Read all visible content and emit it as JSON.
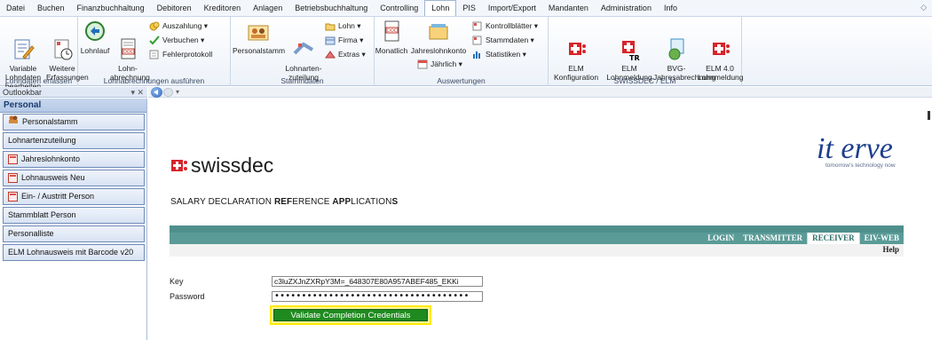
{
  "menu": {
    "tabs": [
      "Datei",
      "Buchen",
      "Finanzbuchhaltung",
      "Debitoren",
      "Kreditoren",
      "Anlagen",
      "Betriebsbuchhaltung",
      "Controlling",
      "Lohn",
      "PIS",
      "Import/Export",
      "Mandanten",
      "Administration",
      "Info"
    ],
    "active_tab": "Lohn"
  },
  "ribbon": {
    "lohndaten": {
      "group_label": "Lohndaten erfassen",
      "variable": "Variable Lohndaten\nbearbeiten",
      "weitere": "Weitere\nErfassungen"
    },
    "lohnabrechnungen": {
      "group_label": "Lohnabrechnungen ausführen",
      "lohnlauf": "Lohnlauf",
      "lohnabrechnung": "Lohn-\nabrechnung",
      "auszahlung": "Auszahlung ▾",
      "verbuchen": "Verbuchen ▾",
      "fehlerprotokoll": "Fehlerprotokoll"
    },
    "stammdaten": {
      "group_label": "Stammdaten",
      "personalstamm": "Personalstamm",
      "lohnartenzuteilung": "Lohnarten-\nzuteilung",
      "lohn": "Lohn ▾",
      "firma": "Firma ▾",
      "extras": "Extras ▾"
    },
    "auswertungen": {
      "group_label": "Auswertungen",
      "monatlich": "Monatlich",
      "jahreslohnkonto": "Jahreslohnkonto",
      "jaehrlich": "Jährlich ▾",
      "kontrollblaetter": "Kontrollblätter ▾",
      "stammdaten": "Stammdaten ▾",
      "statistiken": "Statistiken ▾"
    },
    "swissdec": {
      "group_label": "SWISSDEC / ELM",
      "elm_konfig": "ELM\nKonfiguration",
      "elm_lohnmeldung": "ELM\nLohnmeldung",
      "bvg": "BVG-\nJahresabrechnung",
      "elm40": "ELM 4.0\nLohnmeldung"
    }
  },
  "outlookbar": {
    "title": "Outlookbar",
    "section": "Personal",
    "items": [
      "Personalstamm",
      "Lohnartenzuteilung",
      "Jahreslohnkonto",
      "Lohnausweis Neu",
      "Ein- / Austritt Person",
      "Stammblatt Person",
      "Personalliste",
      "ELM Lohnausweis mit Barcode v20"
    ]
  },
  "page": {
    "swissdec_logo_text": "swissdec",
    "iterve_logo": "it erve",
    "iterve_tagline": "tomorrow's technology now",
    "title_parts": [
      "SALARY DECLARATION ",
      "REF",
      "ERENCE ",
      "APP",
      "LICATION",
      "S"
    ],
    "nav_links": [
      "LOGIN",
      "TRANSMITTER",
      "RECEIVER",
      "EIV-WEB"
    ],
    "nav_selected": "RECEIVER",
    "help": "Help",
    "key_label": "Key",
    "key_value": "c3luZXJnZXRpY3M=_648307E80A957ABEF485_EKKi",
    "password_label": "Password",
    "password_value": "••••••••••••••••••••••••••••••••••••",
    "validate_button": "Validate Completion Credentials"
  },
  "colors": {
    "teal": "#5a9b97",
    "validate_green": "#1f8a1f",
    "highlight_yellow": "#ffea00",
    "iterve_blue": "#1d3f8c"
  }
}
